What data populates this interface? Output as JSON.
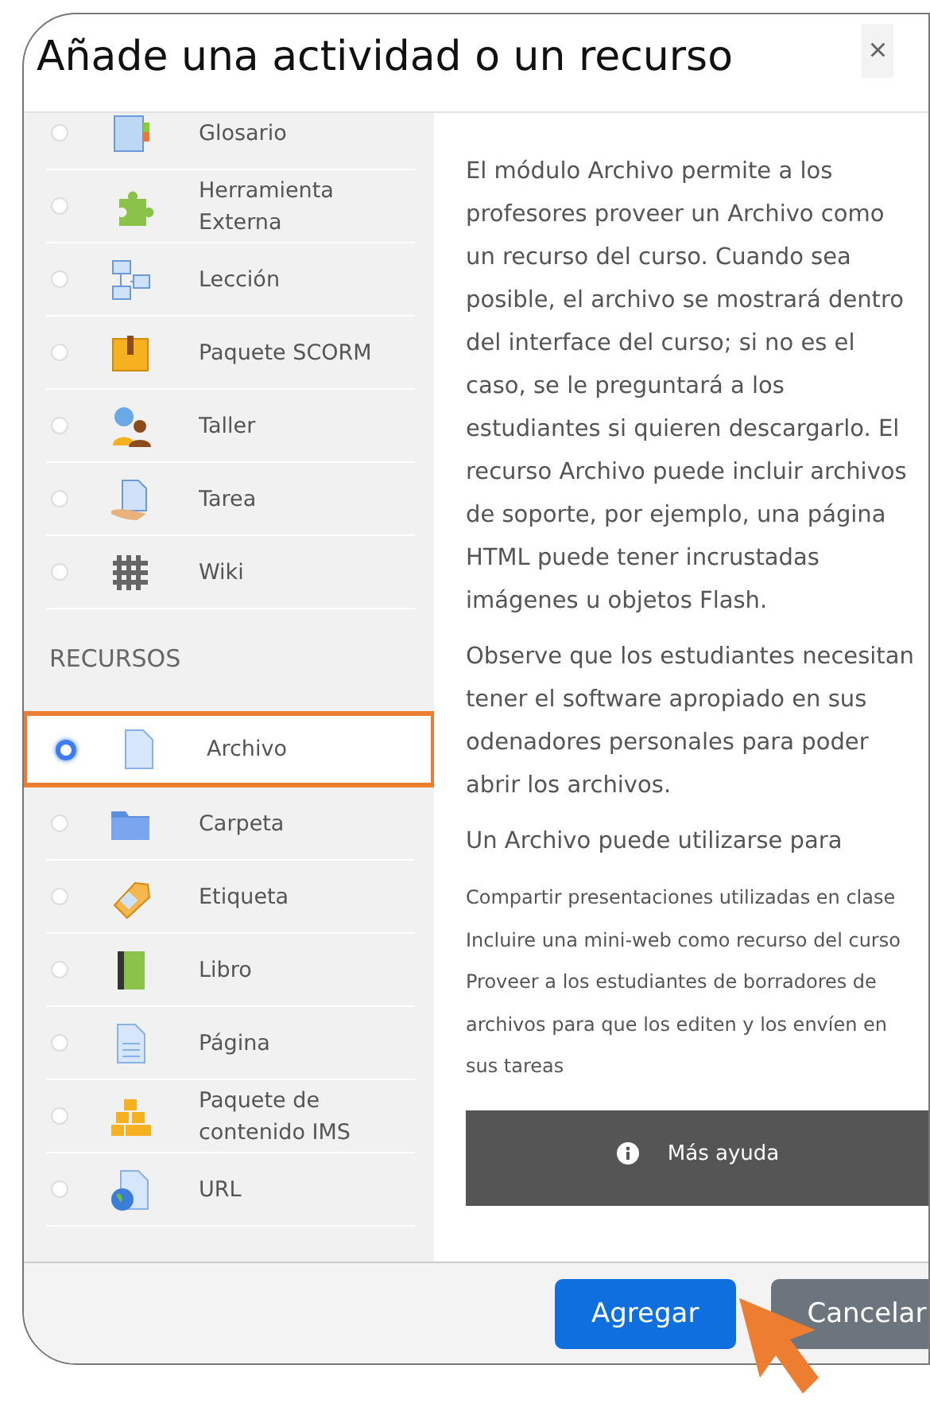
{
  "dialog": {
    "title": "Añade una actividad o un recurso",
    "close": "×"
  },
  "activities": [
    {
      "label": "Glosario",
      "kind": "glossary",
      "selected": false
    },
    {
      "label": "Herramienta Externa",
      "kind": "puzzle",
      "selected": false
    },
    {
      "label": "Lección",
      "kind": "flowchart",
      "selected": false
    },
    {
      "label": "Paquete SCORM",
      "kind": "package",
      "selected": false
    },
    {
      "label": "Taller",
      "kind": "people",
      "selected": false
    },
    {
      "label": "Tarea",
      "kind": "hand",
      "selected": false
    },
    {
      "label": "Wiki",
      "kind": "wiki",
      "selected": false
    }
  ],
  "resources_heading": "RECURSOS",
  "resources": [
    {
      "label": "Archivo",
      "kind": "file",
      "selected": true
    },
    {
      "label": "Carpeta",
      "kind": "folder",
      "selected": false
    },
    {
      "label": "Etiqueta",
      "kind": "tag",
      "selected": false
    },
    {
      "label": "Libro",
      "kind": "book",
      "selected": false
    },
    {
      "label": "Página",
      "kind": "page",
      "selected": false
    },
    {
      "label": "Paquete de contenido IMS",
      "kind": "boxes",
      "selected": false
    },
    {
      "label": "URL",
      "kind": "globe",
      "selected": false
    }
  ],
  "description": {
    "paragraphs": [
      "El módulo Archivo permite a los profesores proveer un Archivo como un recurso del curso. Cuando sea posible, el archivo se mostrará dentro del interface del curso; si no es el caso, se le preguntará a los estudiantes si quieren descargarlo. El recurso Archivo puede incluir archivos de soporte, por ejemplo, una página HTML puede tener incrustadas imágenes u objetos Flash.",
      "Observe que los estudiantes necesitan tener el software apropiado en sus odenadores personales para poder abrir los archivos.",
      "Un Archivo puede utilizarse para"
    ],
    "uses": [
      "Compartir presentaciones utilizadas en clase",
      "Incluire una mini-web como recurso del curso",
      "Proveer a los estudiantes de borradores de archivos para que los editen y los envíen en sus tareas"
    ],
    "help_button": "Más ayuda"
  },
  "buttons": [
    {
      "label": "Agregar",
      "kind": "primary"
    },
    {
      "label": "Cancelar",
      "kind": "secondary"
    }
  ]
}
